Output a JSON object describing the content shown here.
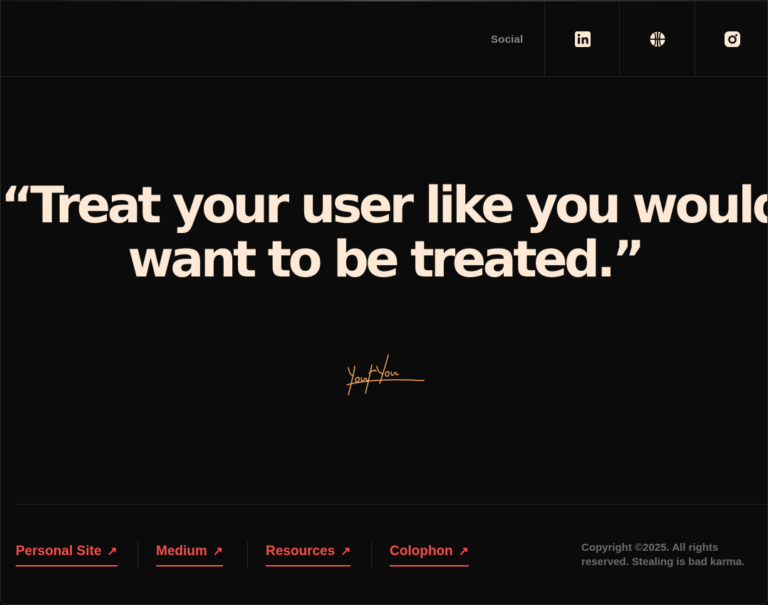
{
  "header": {
    "social_label": "Social",
    "icons": [
      {
        "name": "linkedin-icon",
        "label": "LinkedIn"
      },
      {
        "name": "dribbble-icon",
        "label": "Dribbble"
      },
      {
        "name": "instagram-icon",
        "label": "Instagram"
      }
    ]
  },
  "quote": {
    "line1": "“Treat your user like you would",
    "line2": "want to be treated.”"
  },
  "signature": {
    "text": "You I You"
  },
  "footer": {
    "links": [
      {
        "label": "Personal Site",
        "arrow": "↗"
      },
      {
        "label": "Medium",
        "arrow": "↗"
      },
      {
        "label": "Resources",
        "arrow": "↗"
      },
      {
        "label": "Colophon",
        "arrow": "↗"
      }
    ],
    "copyright": "Copyright ©2025. All rights reserved. Stealing is bad karma."
  },
  "colors": {
    "background": "#0b0b0b",
    "quote_text": "#fde9d6",
    "accent_link": "#f5524a",
    "signature": "#f0a35a",
    "muted_text": "#6d6d6d"
  }
}
